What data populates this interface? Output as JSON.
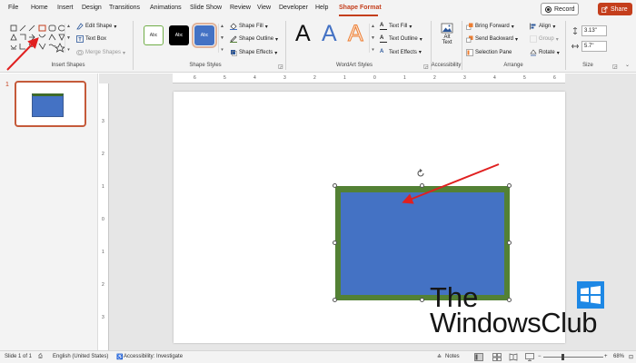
{
  "menu": {
    "tabs": [
      "File",
      "Home",
      "Insert",
      "Design",
      "Transitions",
      "Animations",
      "Slide Show",
      "Review",
      "View",
      "Developer",
      "Help",
      "Shape Format"
    ],
    "active_tab": "Shape Format",
    "record_label": "Record",
    "share_label": "Share"
  },
  "ribbon": {
    "insert_shapes": {
      "label": "Insert Shapes",
      "edit_shape": "Edit Shape",
      "text_box": "Text Box",
      "merge_shapes": "Merge Shapes"
    },
    "shape_styles": {
      "label": "Shape Styles",
      "swatches": [
        "Abc",
        "Abc",
        "Abc"
      ],
      "shape_fill": "Shape Fill",
      "shape_outline": "Shape Outline",
      "shape_effects": "Shape Effects"
    },
    "wordart_styles": {
      "label": "WordArt Styles",
      "samples": [
        "A",
        "A",
        "A"
      ],
      "text_fill": "Text Fill",
      "text_outline": "Text Outline",
      "text_effects": "Text Effects"
    },
    "accessibility": {
      "label": "Accessibility",
      "alt_text_line1": "Alt",
      "alt_text_line2": "Text"
    },
    "arrange": {
      "label": "Arrange",
      "bring_forward": "Bring Forward",
      "send_backward": "Send Backward",
      "selection_pane": "Selection Pane",
      "align": "Align",
      "group": "Group",
      "rotate": "Rotate"
    },
    "size": {
      "label": "Size",
      "height": "3.13\"",
      "width": "5.7\""
    }
  },
  "slides_panel": {
    "slide_number": "1"
  },
  "ruler": {
    "h_ticks": [
      "6",
      "5",
      "4",
      "3",
      "2",
      "1",
      "0",
      "1",
      "2",
      "3",
      "4",
      "5",
      "6"
    ],
    "v_ticks": [
      "3",
      "2",
      "1",
      "0",
      "1",
      "2",
      "3"
    ]
  },
  "watermark": {
    "line1": "The",
    "line2": "WindowsClub"
  },
  "status": {
    "slide_info": "Slide 1 of 1",
    "language": "English (United States)",
    "accessibility": "Accessibility: Investigate",
    "notes": "Notes",
    "zoom": "68%"
  },
  "colors": {
    "accent": "#c43e1c",
    "shape_fill": "#4472c4",
    "shape_outline": "#538135",
    "arrow": "#e02020"
  }
}
